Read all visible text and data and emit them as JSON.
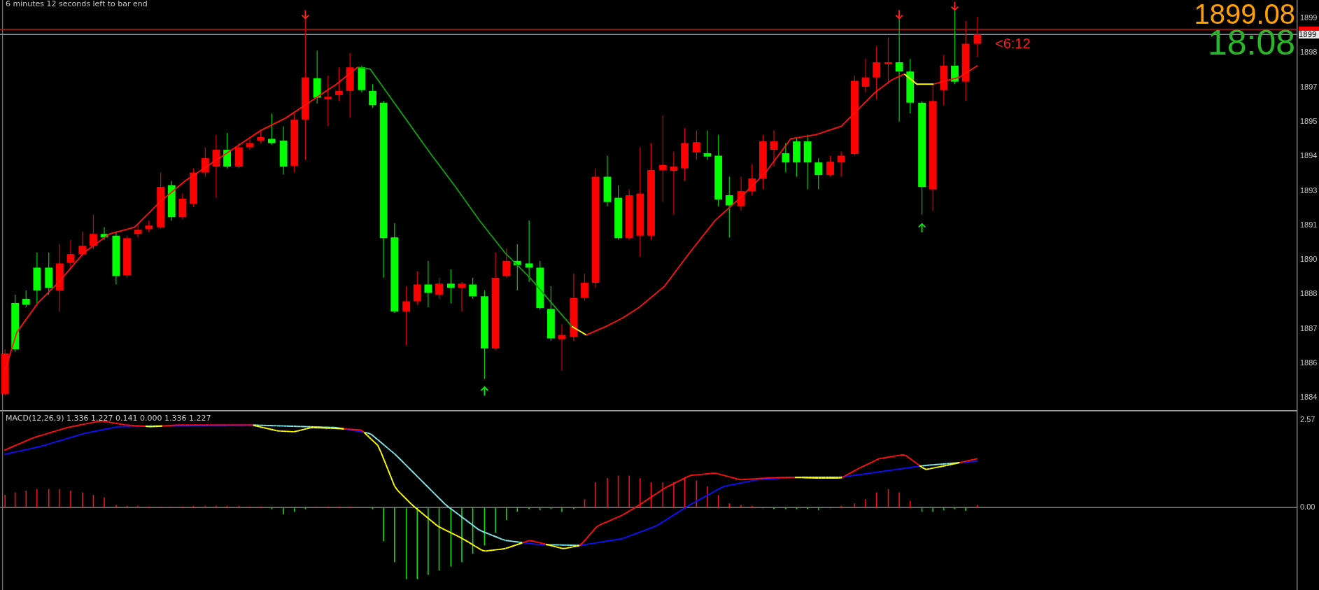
{
  "countdown": "6 minutes 12 seconds left to bar end",
  "price": "1899.08",
  "time_left": "18:08",
  "bar_timer": "<6:12",
  "price_axis": [
    "1899",
    "1898",
    "1897",
    "1895",
    "1894",
    "1893",
    "1891",
    "1890",
    "1888",
    "1887",
    "1886",
    "1884"
  ],
  "bid_tag": "1899",
  "macd": {
    "label": "MACD(12,26,9) 1.336 1.227 0.141 0.000 1.336 1.227",
    "axis": [
      "2.57",
      "0.00"
    ]
  }
}
